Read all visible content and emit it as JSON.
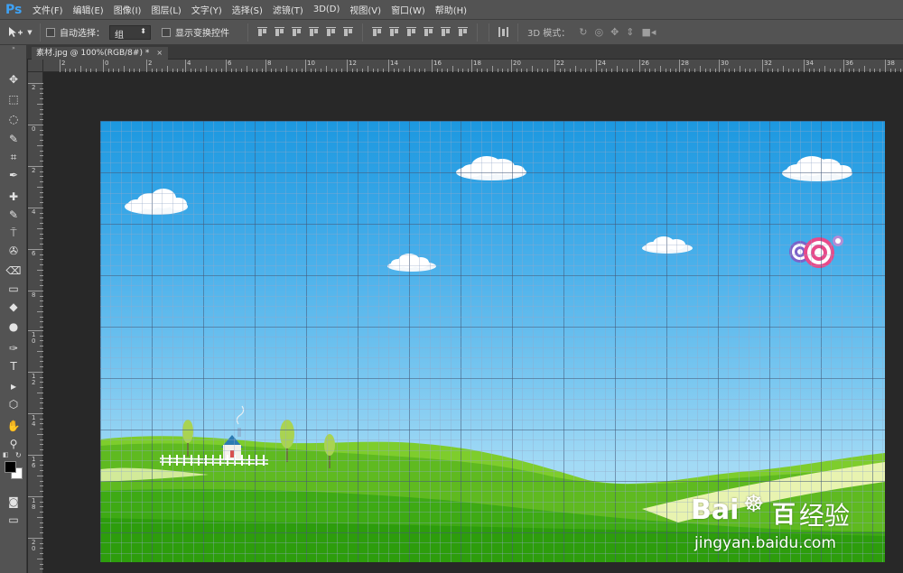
{
  "app": {
    "logo": "Ps",
    "brand_color": "#3ea2f5"
  },
  "menubar": {
    "items": [
      "文件(F)",
      "编辑(E)",
      "图像(I)",
      "图层(L)",
      "文字(Y)",
      "选择(S)",
      "滤镜(T)",
      "3D(D)",
      "视图(V)",
      "窗口(W)",
      "帮助(H)"
    ]
  },
  "options": {
    "move_icon": "move-tool-icon",
    "auto_select_label": "自动选择：",
    "auto_select_value": "组",
    "show_transform_label": "显示变换控件",
    "mode_3d_label": "3D 模式："
  },
  "document": {
    "tab_title": "素材.jpg @ 100%(RGB/8#) *",
    "close": "×"
  },
  "ruler_top": [
    "2",
    "0",
    "2",
    "4",
    "6",
    "8",
    "10",
    "12",
    "14",
    "16",
    "18",
    "20",
    "22",
    "24",
    "26",
    "28",
    "30",
    "32",
    "34",
    "36",
    "38"
  ],
  "ruler_left": [
    "2",
    "0",
    "2",
    "4",
    "6",
    "8",
    "1 0",
    "1 2",
    "1 4",
    "1 6",
    "1 8",
    "2 0"
  ],
  "toolbar": {
    "tools": [
      "move-tool",
      "marquee-tool",
      "lasso-tool",
      "quick-select-tool",
      "crop-tool",
      "eyedropper-tool",
      "healing-tool",
      "brush-tool",
      "clone-stamp-tool",
      "history-brush-tool",
      "eraser-tool",
      "gradient-tool",
      "blur-tool",
      "dodge-tool",
      "pen-tool",
      "type-tool",
      "path-select-tool",
      "shape-tool",
      "hand-tool",
      "zoom-tool",
      "color-swatches",
      "quick-mask",
      "screen-mode"
    ],
    "type_glyph": "T"
  },
  "watermark": {
    "brand": "Bai",
    "brand2": "百",
    "cn": "经验",
    "url": "jingyan.baidu.com"
  },
  "colors": {
    "foreground": "#000000",
    "background": "#ffffff"
  }
}
